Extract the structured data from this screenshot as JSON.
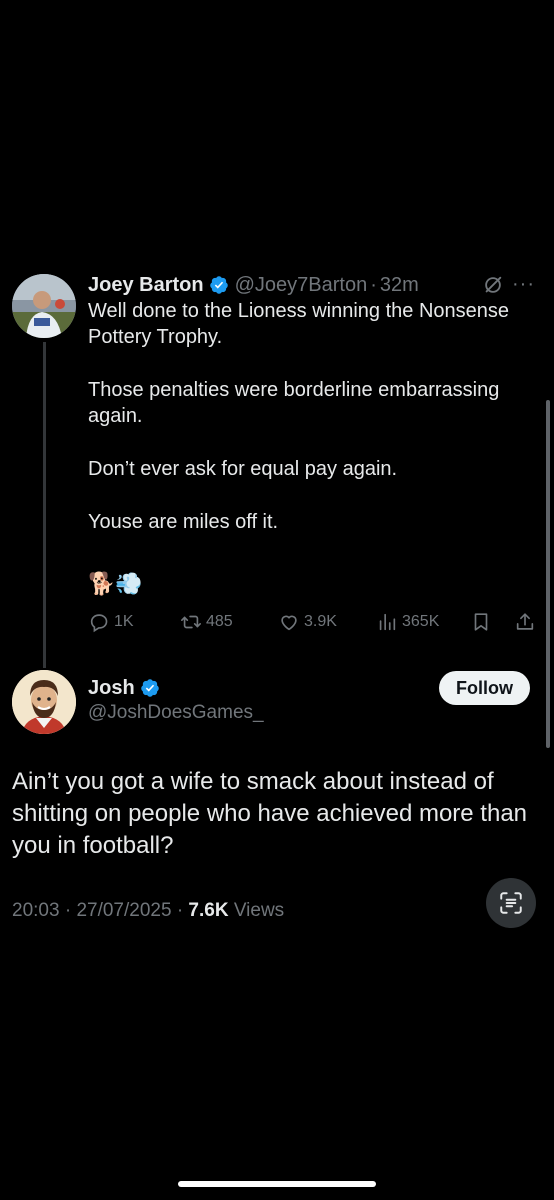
{
  "parent_tweet": {
    "author_name": "Joey Barton",
    "handle": "@Joey7Barton",
    "separator": "·",
    "time_ago": "32m",
    "paragraphs": [
      "Well done to the Lioness winning the Nonsense Pottery Trophy.",
      "Those penalties were borderline embarrassing again.",
      "Don’t ever ask for equal pay again.",
      "Youse are miles off it."
    ],
    "emojis": "🐕💨",
    "actions": {
      "replies": "1K",
      "reposts": "485",
      "likes": "3.9K",
      "views": "365K"
    }
  },
  "reply_tweet": {
    "author_name": "Josh",
    "handle": "@JoshDoesGames_",
    "follow_label": "Follow",
    "text": "Ain’t you got a wife to smack about instead of shitting on people who have achieved more than you in football?",
    "time": "20:03",
    "date": "27/07/2025",
    "views_count": "7.6K",
    "views_label": "Views",
    "separator": "·"
  },
  "colors": {
    "background": "#000000",
    "text_primary": "#e7e9ea",
    "text_secondary": "#71767b",
    "verified_blue": "#1d9bf0",
    "follow_bg": "#eff3f4"
  }
}
